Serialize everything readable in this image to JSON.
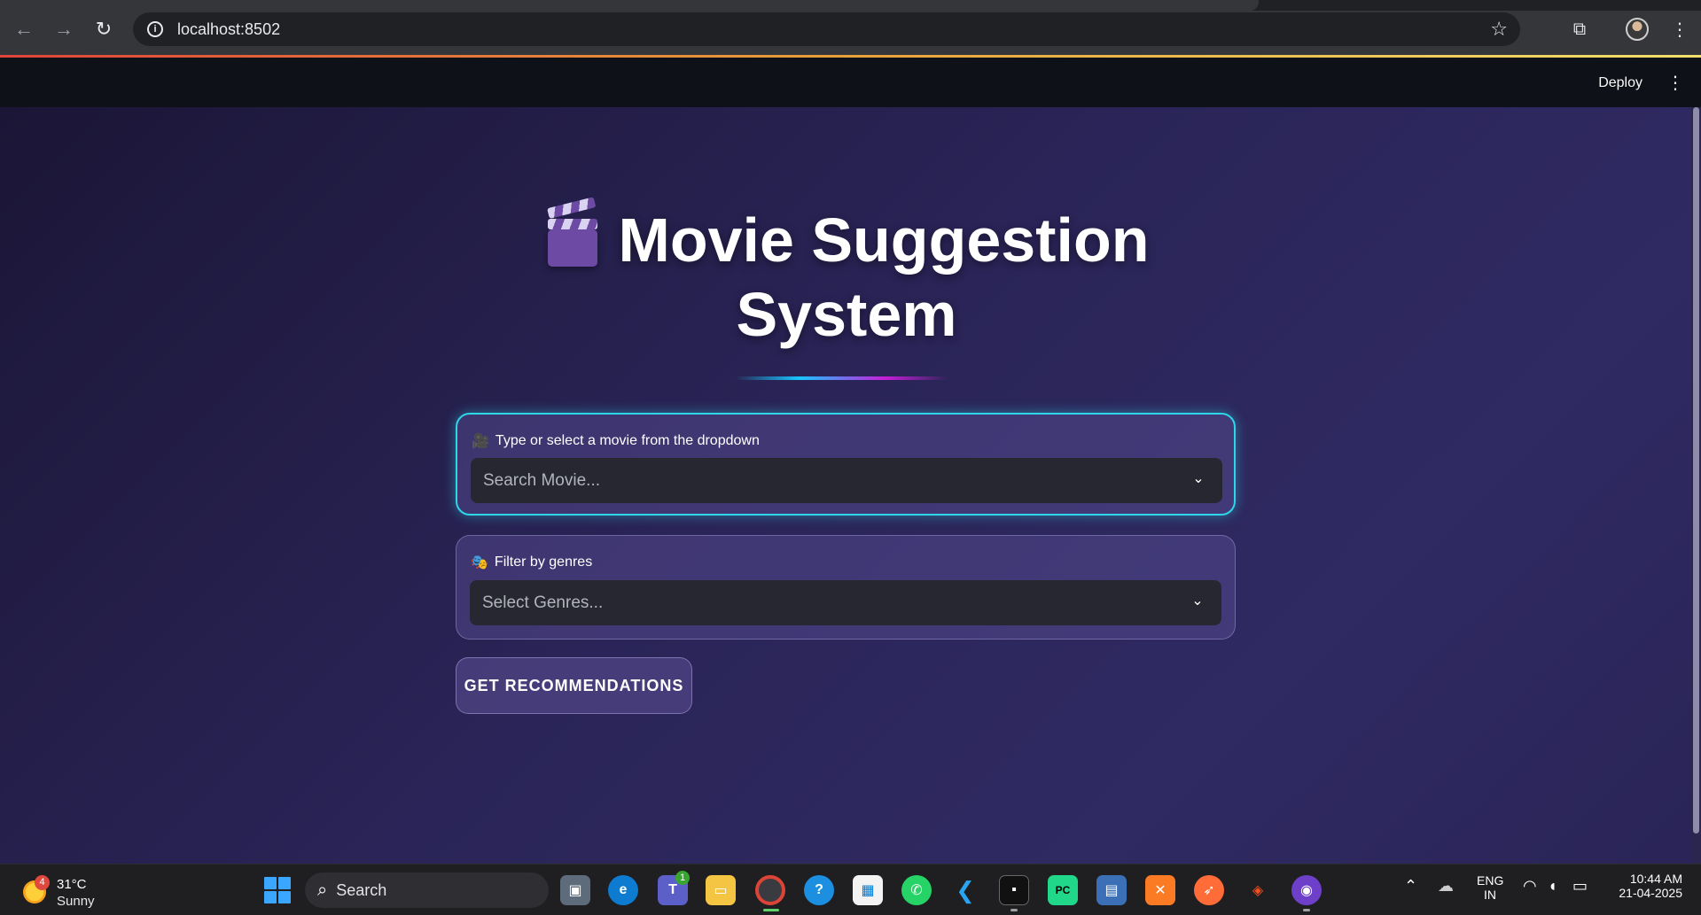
{
  "browser": {
    "url": "localhost:8502"
  },
  "header": {
    "deploy_label": "Deploy"
  },
  "app": {
    "title": "Movie Suggestion System",
    "movie_select": {
      "icon": "🎥",
      "label": "Type or select a movie from the dropdown",
      "placeholder": "Search Movie..."
    },
    "genre_select": {
      "icon": "🎭",
      "label": "Filter by genres",
      "placeholder": "Select Genres..."
    },
    "recommend_button": "GET RECOMMENDATIONS"
  },
  "taskbar": {
    "weather": {
      "badge": "4",
      "temp": "31°C",
      "condition": "Sunny"
    },
    "search_label": "Search",
    "teams_badge": "1",
    "language": {
      "line1": "ENG",
      "line2": "IN"
    },
    "clock": {
      "time": "10:44 AM",
      "date": "21-04-2025"
    }
  },
  "colors": {
    "focus_border": "#2fd6e8",
    "app_bg": "#2a2457",
    "header_bg": "#0e1117"
  }
}
